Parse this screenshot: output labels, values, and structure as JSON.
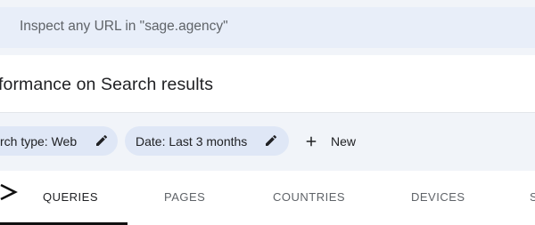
{
  "search": {
    "placeholder": "Inspect any URL in \"sage.agency\""
  },
  "header": {
    "title": "formance on Search results"
  },
  "filters": {
    "chips": [
      {
        "label": "rch type: Web",
        "icon": "edit-icon"
      },
      {
        "label": "Date: Last 3 months",
        "icon": "edit-icon"
      }
    ],
    "new_label": "New",
    "new_icon": "plus-icon"
  },
  "tabs": {
    "items": [
      {
        "label": "QUERIES",
        "active": true
      },
      {
        "label": "PAGES",
        "active": false
      },
      {
        "label": "COUNTRIES",
        "active": false
      },
      {
        "label": "DEVICES",
        "active": false
      },
      {
        "label": "S",
        "active": false
      }
    ],
    "scroll_icon": "chevron-right-icon"
  },
  "colors": {
    "band": "#f1f4f9",
    "search_bar": "#e8eef9",
    "chip": "#dfe7f6",
    "text": "#202124",
    "muted_text": "#5f6368"
  }
}
